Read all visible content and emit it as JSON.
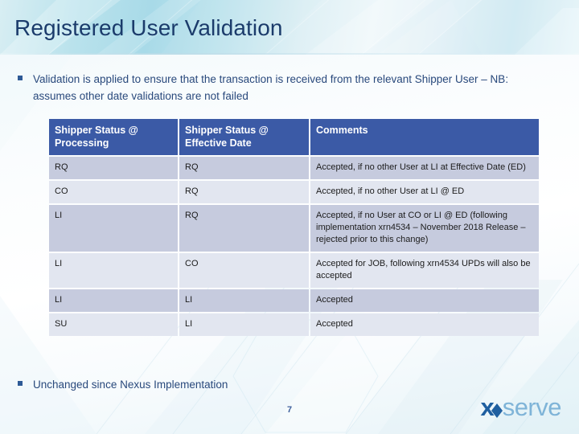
{
  "slide": {
    "title": "Registered User Validation",
    "page_number": "7"
  },
  "bullets": {
    "top": "Validation is applied to ensure that the transaction is received from the relevant Shipper User – NB: assumes other date validations are not failed",
    "bottom": "Unchanged since Nexus Implementation"
  },
  "table": {
    "headers": [
      "Shipper Status @ Processing",
      "Shipper Status @ Effective Date",
      "Comments"
    ],
    "rows": [
      {
        "status_processing": "RQ",
        "status_effective": "RQ",
        "comments": "Accepted, if no other User at LI at Effective Date (ED)"
      },
      {
        "status_processing": "CO",
        "status_effective": "RQ",
        "comments": "Accepted, if no other User at LI @ ED"
      },
      {
        "status_processing": "LI",
        "status_effective": "RQ",
        "comments": "Accepted, if no User at CO or LI @ ED (following implementation xrn4534 – November 2018 Release – rejected prior to this change)"
      },
      {
        "status_processing": "LI",
        "status_effective": "CO",
        "comments": "Accepted for JOB, following xrn4534 UPDs will also be accepted"
      },
      {
        "status_processing": "LI",
        "status_effective": "LI",
        "comments": "Accepted"
      },
      {
        "status_processing": "SU",
        "status_effective": "LI",
        "comments": "Accepted"
      }
    ]
  },
  "logo": {
    "part1": "x",
    "icon": "diamond-icon",
    "part2": "serve"
  },
  "colors": {
    "title_blue": "#1b3b6b",
    "bullet_blue": "#29497c",
    "table_header_blue": "#3b5aa6",
    "row_dark": "#c6cbde",
    "row_light": "#e2e6f0",
    "logo_dark": "#1f5fa0",
    "logo_light": "#7fb4d8"
  }
}
